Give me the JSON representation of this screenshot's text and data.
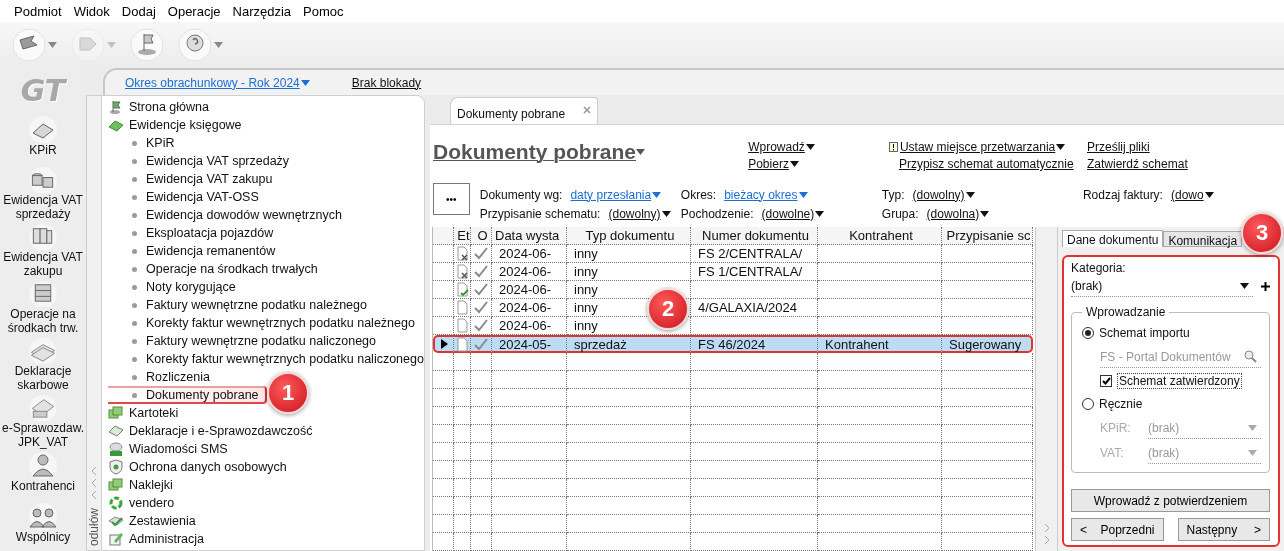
{
  "menu": [
    "Podmiot",
    "Widok",
    "Dodaj",
    "Operacje",
    "Narzędzia",
    "Pomoc"
  ],
  "toolbar": [
    {
      "kind": "send",
      "dropdown": true,
      "disabled": false
    },
    {
      "kind": "receive",
      "dropdown": true,
      "disabled": true
    },
    {
      "kind": "flag",
      "dropdown": false,
      "disabled": false
    },
    {
      "kind": "help",
      "dropdown": true,
      "disabled": false
    }
  ],
  "logo": "GT",
  "modules": [
    {
      "label": "KPiR",
      "kind": "book"
    },
    {
      "label": "Ewidencja VAT sprzedaży",
      "kind": "coins"
    },
    {
      "label": "Ewidencja VAT zakupu",
      "kind": "binders"
    },
    {
      "label": "Operacje na środkach trw.",
      "kind": "cabinet"
    },
    {
      "label": "Deklaracje skarbowe",
      "kind": "papers"
    },
    {
      "label": "e-Sprawozdaw. JPK_VAT",
      "kind": "jpk"
    },
    {
      "label": "Kontrahenci",
      "kind": "person"
    },
    {
      "label": "Wspólnicy",
      "kind": "people"
    }
  ],
  "period": {
    "label": "Okres obrachunkowy - Rok 2024",
    "lock": "Brak blokady"
  },
  "tree_strip": {
    "label": "odułów"
  },
  "tree": [
    {
      "label": "Strona główna",
      "kind": "flag"
    },
    {
      "label": "Ewidencje księgowe",
      "kind": "book",
      "children": [
        {
          "label": "KPiR",
          "highlighted": false
        },
        {
          "label": "Ewidencja VAT sprzedaży",
          "highlighted": false
        },
        {
          "label": "Ewidencja VAT zakupu",
          "highlighted": false
        },
        {
          "label": "Ewidencja VAT-OSS",
          "highlighted": false
        },
        {
          "label": "Ewidencja dowodów wewnętrznych",
          "highlighted": false
        },
        {
          "label": "Eksploatacja pojazdów",
          "highlighted": false
        },
        {
          "label": "Ewidencja remanentów",
          "highlighted": false
        },
        {
          "label": "Operacje na środkach trwałych",
          "highlighted": false
        },
        {
          "label": "Noty korygujące",
          "highlighted": false
        },
        {
          "label": "Faktury wewnętrzne podatku należnego",
          "highlighted": false
        },
        {
          "label": "Korekty faktur wewnętrznych podatku należnego",
          "highlighted": false
        },
        {
          "label": "Faktury wewnętrzne podatku naliczonego",
          "highlighted": false
        },
        {
          "label": "Korekty faktur wewnętrznych podatku naliczonego",
          "highlighted": false
        },
        {
          "label": "Rozliczenia",
          "highlighted": false
        },
        {
          "label": "Dokumenty pobrane",
          "highlighted": true
        }
      ]
    },
    {
      "label": "Kartoteki",
      "kind": "folders"
    },
    {
      "label": "Deklaracje i e-Sprawozdawczość",
      "kind": "card"
    },
    {
      "label": "Wiadomości SMS",
      "kind": "sms"
    },
    {
      "label": "Ochrona danych osobowych",
      "kind": "shield"
    },
    {
      "label": "Naklejki",
      "kind": "folders"
    },
    {
      "label": "vendero",
      "kind": "ring"
    },
    {
      "label": "Zestawienia",
      "kind": "check"
    },
    {
      "label": "Administracja",
      "kind": "pencil"
    }
  ],
  "tabs": [
    {
      "label": "Dokumenty pobrane",
      "selected": true
    }
  ],
  "title": "Dokumenty pobrane",
  "actions": [
    [
      {
        "label": "Wprowadź",
        "dropdown": true,
        "warning": false
      },
      {
        "label": "Pobierz",
        "dropdown": true,
        "warning": false
      }
    ],
    [
      {
        "label": "Ustaw miejsce przetwarzania",
        "dropdown": true,
        "warning": true
      },
      {
        "label": "Przypisz schemat automatycznie",
        "dropdown": false,
        "warning": false
      }
    ],
    [
      {
        "label": "Prześlij pliki",
        "dropdown": false,
        "warning": false
      },
      {
        "label": "Zatwierdź schemat",
        "dropdown": false,
        "warning": false
      }
    ]
  ],
  "more_button": "•••",
  "filters": [
    [
      {
        "label": "Dokumenty wg:",
        "value": "daty przesłania",
        "kind": "link"
      },
      {
        "label": "Przypisanie schematu:",
        "value": "(dowolny)",
        "kind": "plain"
      }
    ],
    [
      {
        "label": "Okres:",
        "value": "bieżacy okres",
        "kind": "link"
      },
      {
        "label": "Pochodzenie:",
        "value": "(dowolne)",
        "kind": "plain"
      }
    ],
    [
      {
        "label": "Typ:",
        "value": "(dowolny)",
        "kind": "plain"
      },
      {
        "label": "Grupa:",
        "value": "(dowolna)",
        "kind": "plain"
      }
    ],
    [
      {
        "label": "Rodzaj faktury:",
        "value": "(dowo",
        "kind": "plain"
      }
    ]
  ],
  "table": {
    "columns": [
      "Et",
      "O",
      "Data wysta",
      "Typ dokumentu",
      "Numer dokumentu",
      "Kontrahent",
      "Przypisanie sc"
    ],
    "rows": [
      {
        "kind": "rejected",
        "o_checked": true,
        "date": "2024-06-",
        "type": "inny",
        "number": "FS 2/CENTRALA/",
        "selected": false,
        "highlighted": false
      },
      {
        "kind": "rejected",
        "o_checked": true,
        "date": "2024-06-",
        "type": "inny",
        "number": "FS 1/CENTRALA/",
        "selected": false,
        "highlighted": false
      },
      {
        "kind": "approved",
        "o_checked": true,
        "date": "2024-06-",
        "type": "inny",
        "selected": false,
        "highlighted": false
      },
      {
        "kind": "plain",
        "o_checked": true,
        "date": "2024-06-",
        "type": "inny",
        "number": "4/GALAXIA/2024",
        "selected": false,
        "highlighted": false
      },
      {
        "kind": "plain",
        "o_checked": true,
        "date": "2024-06-",
        "type": "inny",
        "selected": false,
        "highlighted": false
      },
      {
        "kind": "plain",
        "o_checked": true,
        "date": "2024-05-",
        "type": "sprzedaż",
        "number": "FS 46/2024",
        "contractor": "Kontrahent",
        "scheme": "Sugerowany",
        "selected": true,
        "highlighted": true
      }
    ]
  },
  "side_tabs": [
    {
      "label": "Dane dokumentu",
      "selected": true
    },
    {
      "label": "Komunikacja",
      "selected": false
    }
  ],
  "side_panel": {
    "highlighted": true,
    "category_label": "Kategoria:",
    "category_value": "(brak)",
    "group_label": "Wprowadzanie",
    "radios": [
      {
        "label": "Schemat importu",
        "selected": true
      },
      {
        "label": "Ręcznie",
        "selected": false
      }
    ],
    "schema_field": {
      "value": "FS - Portal Dokumentów",
      "disabled": true
    },
    "approved": {
      "label": "Schemat zatwierdzony",
      "checked": true
    },
    "manual_fields": [
      {
        "label": "KPiR:",
        "value": "(brak)",
        "disabled": true
      },
      {
        "label": "VAT:",
        "value": "(brak)",
        "disabled": true
      }
    ],
    "confirm_button": "Wprowadź z potwierdzeniem",
    "nav_buttons": [
      {
        "label": "Poprzedni",
        "arrow": "<",
        "kind": "back"
      },
      {
        "label": "Następny",
        "arrow": ">",
        "kind": "forward"
      }
    ]
  },
  "annotations": [
    {
      "number": "1"
    },
    {
      "number": "2"
    },
    {
      "number": "3"
    }
  ]
}
